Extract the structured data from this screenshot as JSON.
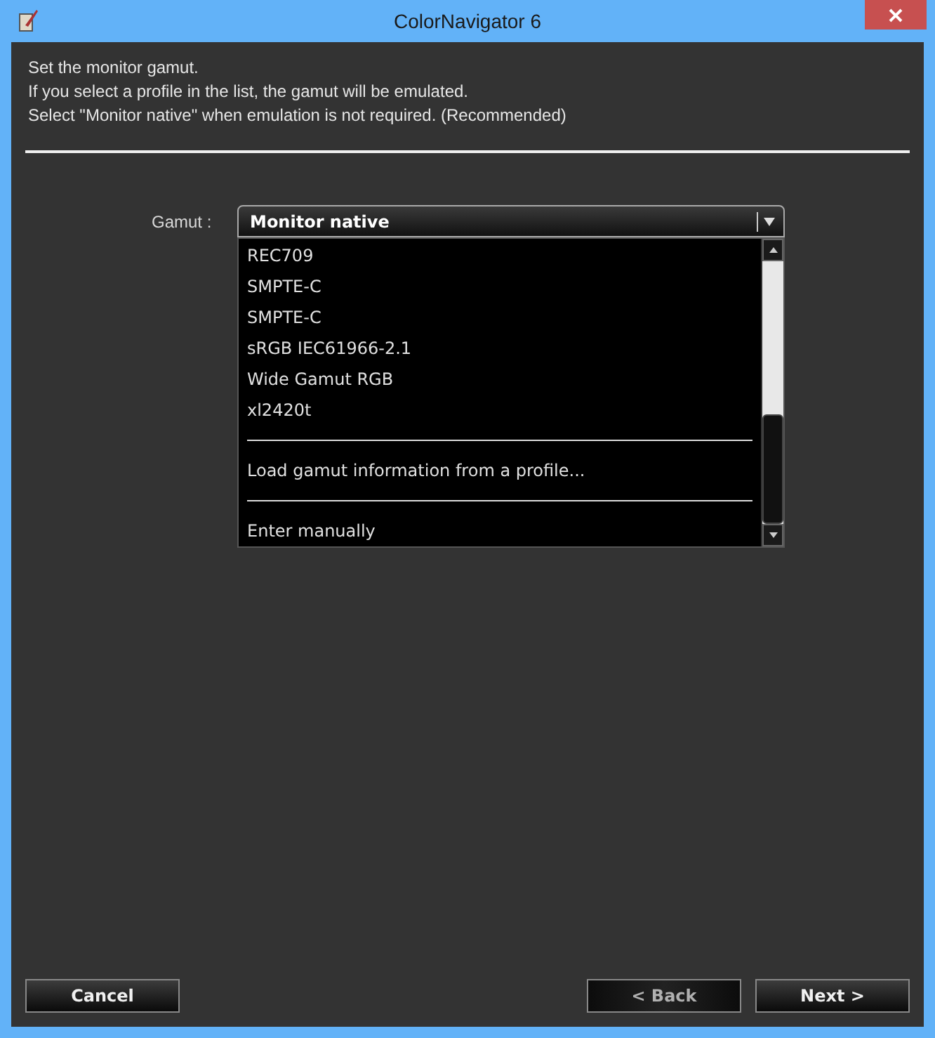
{
  "window": {
    "title": "ColorNavigator 6"
  },
  "instructions": [
    "Set the monitor gamut.",
    "If you select a profile in the list,  the gamut will be emulated.",
    "Select \"Monitor native\" when emulation is not required. (Recommended)"
  ],
  "gamut": {
    "label": "Gamut :",
    "value": "Monitor native",
    "expanded": true,
    "options": [
      {
        "kind": "item",
        "label": "REC709"
      },
      {
        "kind": "item",
        "label": "SMPTE-C"
      },
      {
        "kind": "item",
        "label": "SMPTE-C"
      },
      {
        "kind": "item",
        "label": "sRGB IEC61966-2.1"
      },
      {
        "kind": "item",
        "label": "Wide Gamut RGB"
      },
      {
        "kind": "item",
        "label": "xl2420t"
      },
      {
        "kind": "separator"
      },
      {
        "kind": "item",
        "label": "Load gamut information from a profile..."
      },
      {
        "kind": "separator"
      },
      {
        "kind": "item",
        "label": "Enter manually"
      }
    ]
  },
  "buttons": [
    {
      "label": "Cancel",
      "disabled": false
    },
    {
      "label": "< Back",
      "disabled": true
    },
    {
      "label": "Next >",
      "disabled": false
    }
  ]
}
